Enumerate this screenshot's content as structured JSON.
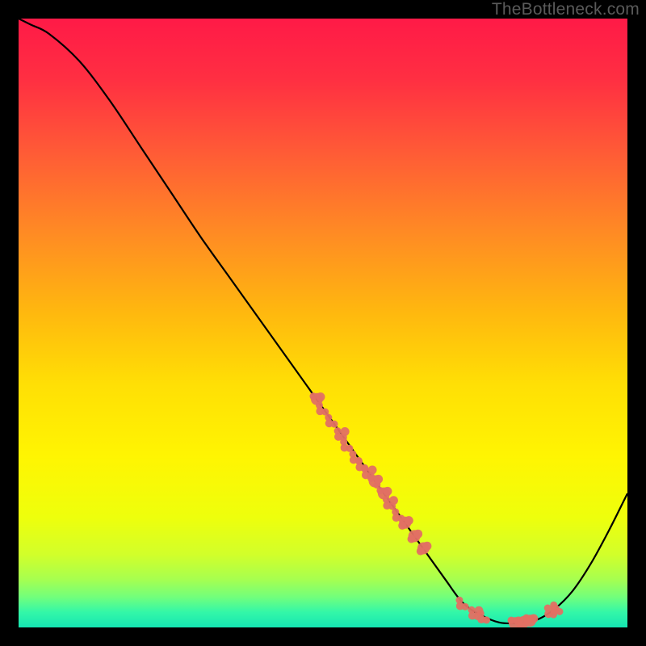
{
  "watermark": "TheBottleneck.com",
  "chart_data": {
    "type": "line",
    "title": "",
    "xlabel": "",
    "ylabel": "",
    "xlim": [
      0,
      100
    ],
    "ylim": [
      0,
      100
    ],
    "series": [
      {
        "name": "curve",
        "x": [
          0,
          2,
          5,
          10,
          15,
          20,
          25,
          30,
          35,
          40,
          45,
          50,
          55,
          60,
          65,
          70,
          73,
          76,
          79,
          82,
          85,
          88,
          91,
          94,
          97,
          100
        ],
        "values": [
          100,
          99,
          97.5,
          93,
          86.5,
          79,
          71.5,
          64,
          57,
          50,
          43,
          36,
          29,
          22,
          15,
          8,
          4,
          2,
          0.8,
          0.7,
          1.2,
          3,
          6,
          10.5,
          16,
          22
        ]
      }
    ],
    "markers": [
      {
        "x": 49.0,
        "y": 37.5
      },
      {
        "x": 50.0,
        "y": 36.0
      },
      {
        "x": 51.5,
        "y": 34.0
      },
      {
        "x": 53.0,
        "y": 31.8
      },
      {
        "x": 54.0,
        "y": 30.0
      },
      {
        "x": 55.5,
        "y": 28.0
      },
      {
        "x": 56.5,
        "y": 26.8
      },
      {
        "x": 57.5,
        "y": 25.5
      },
      {
        "x": 58.5,
        "y": 24.0
      },
      {
        "x": 60.0,
        "y": 22.0
      },
      {
        "x": 61.0,
        "y": 20.5
      },
      {
        "x": 62.5,
        "y": 18.5
      },
      {
        "x": 63.5,
        "y": 17.2
      },
      {
        "x": 65.0,
        "y": 15.0
      },
      {
        "x": 66.5,
        "y": 13.0
      },
      {
        "x": 73.0,
        "y": 4.0
      },
      {
        "x": 75.0,
        "y": 2.4
      },
      {
        "x": 76.5,
        "y": 1.8
      },
      {
        "x": 81.5,
        "y": 0.7
      },
      {
        "x": 83.0,
        "y": 0.9
      },
      {
        "x": 84.0,
        "y": 1.1
      },
      {
        "x": 87.5,
        "y": 2.7
      },
      {
        "x": 88.5,
        "y": 3.2
      }
    ],
    "gradient_stops": [
      {
        "offset": 0.0,
        "color": "#ff1a47"
      },
      {
        "offset": 0.1,
        "color": "#ff2f42"
      },
      {
        "offset": 0.22,
        "color": "#ff5b36"
      },
      {
        "offset": 0.35,
        "color": "#ff8a24"
      },
      {
        "offset": 0.48,
        "color": "#ffb70f"
      },
      {
        "offset": 0.6,
        "color": "#ffdf05"
      },
      {
        "offset": 0.72,
        "color": "#fff502"
      },
      {
        "offset": 0.82,
        "color": "#eeff0c"
      },
      {
        "offset": 0.88,
        "color": "#d2ff2a"
      },
      {
        "offset": 0.92,
        "color": "#a8ff4e"
      },
      {
        "offset": 0.95,
        "color": "#72ff7c"
      },
      {
        "offset": 0.975,
        "color": "#33f7a8"
      },
      {
        "offset": 1.0,
        "color": "#15e5b2"
      }
    ],
    "marker_color": "#e27063",
    "curve_color": "#000000"
  }
}
